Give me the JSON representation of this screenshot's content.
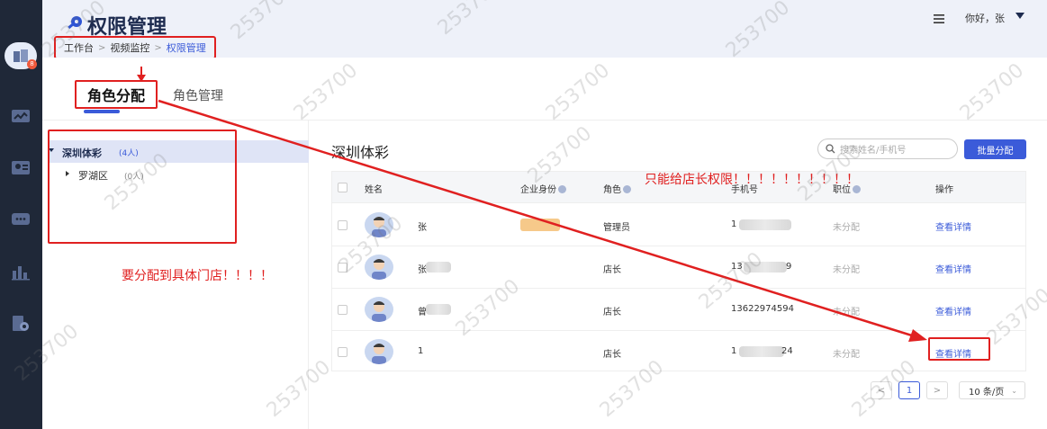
{
  "header": {
    "title": "权限管理",
    "greeting": "你好，张",
    "breadcrumb": [
      "工作台",
      "视频监控",
      "权限管理"
    ]
  },
  "tabs": [
    {
      "label": "角色分配",
      "active": true
    },
    {
      "label": "角色管理",
      "active": false
    }
  ],
  "tree": [
    {
      "label": "深圳体彩",
      "count": "(4人)",
      "expanded": true
    },
    {
      "label": "罗湖区",
      "count": "(0人)",
      "expanded": false
    }
  ],
  "content": {
    "title": "深圳体彩",
    "search_placeholder": "搜索姓名/手机号",
    "batch_button": "批量分配"
  },
  "table": {
    "columns": [
      "姓名",
      "企业身份",
      "角色",
      "手机号",
      "职位",
      "操作"
    ],
    "rows": [
      {
        "name": "张",
        "role": "管理员",
        "phone_prefix": "1",
        "phone_suffix": "",
        "position": "未分配",
        "action": "查看详情",
        "identity_tag": true
      },
      {
        "name": "张",
        "role": "店长",
        "phone_prefix": "13",
        "phone_suffix": "9",
        "position": "未分配",
        "action": "查看详情",
        "identity_tag": false
      },
      {
        "name": "曾",
        "role": "店长",
        "phone_prefix": "13622974594",
        "phone_suffix": "",
        "position": "未分配",
        "action": "查看详情",
        "identity_tag": false
      },
      {
        "name": "1",
        "role": "店长",
        "phone_prefix": "1",
        "phone_suffix": "24",
        "position": "未分配",
        "action": "查看详情",
        "identity_tag": false
      }
    ]
  },
  "pagination": {
    "prev": "<",
    "current": "1",
    "next": ">",
    "page_size": "10 条/页"
  },
  "annotations": {
    "store_manager_note": "只能给店长权限！！！！！！！！！！",
    "store_note": "要分配到具体门店！！！！"
  },
  "watermark": "253700",
  "colors": {
    "rail": "#1f2838",
    "accent": "#3b5bd9",
    "annotation": "#e02020"
  },
  "rail_icons": [
    "home-icon",
    "chart-monitor-icon",
    "id-card-icon",
    "message-icon",
    "bar-chart-icon",
    "settings-file-icon"
  ]
}
